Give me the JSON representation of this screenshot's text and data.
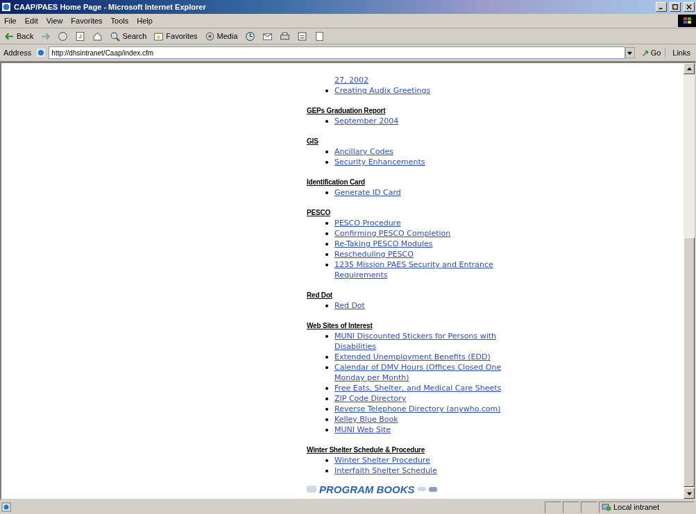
{
  "window": {
    "title": "CAAP/PAES Home Page - Microsoft Internet Explorer"
  },
  "menu": [
    "File",
    "Edit",
    "View",
    "Favorites",
    "Tools",
    "Help"
  ],
  "toolbar": [
    {
      "kind": "back",
      "label": "Back"
    },
    {
      "kind": "forward"
    },
    {
      "kind": "stop"
    },
    {
      "kind": "refresh"
    },
    {
      "kind": "home"
    },
    {
      "kind": "search",
      "label": "Search"
    },
    {
      "kind": "favorites",
      "label": "Favorites"
    },
    {
      "kind": "media",
      "label": "Media"
    },
    {
      "kind": "history"
    },
    {
      "kind": "mail"
    },
    {
      "kind": "print"
    },
    {
      "kind": "edit"
    },
    {
      "kind": "discuss"
    }
  ],
  "address_bar": {
    "label": "Address",
    "value": "http://dhsintranet/Caap/index.cfm",
    "go": "Go",
    "links": "Links"
  },
  "sections": [
    {
      "items": [
        {
          "kind": "continuation",
          "text": "27, 2002"
        },
        {
          "kind": "link",
          "text": "Creating Audix Greetings"
        }
      ]
    },
    {
      "heading": "GEPs Graduation Report",
      "items": [
        {
          "kind": "link",
          "text": "September 2004"
        }
      ]
    },
    {
      "heading": "GIS",
      "items": [
        {
          "kind": "link",
          "text": "Ancillary Codes"
        },
        {
          "kind": "link",
          "text": "Security Enhancements"
        }
      ]
    },
    {
      "heading": "Identification Card",
      "items": [
        {
          "kind": "link",
          "text": "Generate ID Card"
        }
      ]
    },
    {
      "heading": "PESCO",
      "items": [
        {
          "kind": "link",
          "text": "PESCO Procedure"
        },
        {
          "kind": "link",
          "text": "Confirming PESCO Completion"
        },
        {
          "kind": "link",
          "text": "Re-Taking PESCO Modules"
        },
        {
          "kind": "link",
          "text": "Rescheduling PESCO"
        },
        {
          "kind": "link",
          "text": "1235 Mission PAES Security and Entrance Requirements"
        }
      ]
    },
    {
      "heading": "Red Dot",
      "items": [
        {
          "kind": "link",
          "text": "Red Dot"
        }
      ]
    },
    {
      "heading": "Web Sites of Interest",
      "items": [
        {
          "kind": "link",
          "text": "MUNI Discounted Stickers for Persons with Disabilities"
        },
        {
          "kind": "link",
          "text": "Extended Unemployment Benefits (EDD)"
        },
        {
          "kind": "link",
          "text": "Calendar of DMV Hours (Offices Closed One Monday per Month)"
        },
        {
          "kind": "link",
          "text": "Free Eats, Shelter, and Medical Care Sheets"
        },
        {
          "kind": "link",
          "text": "ZIP Code Directory"
        },
        {
          "kind": "link",
          "text": "Reverse Telephone Directory (anywho.com)"
        },
        {
          "kind": "link",
          "text": "Kelley Blue Book"
        },
        {
          "kind": "link",
          "text": "MUNI Web Site"
        }
      ]
    },
    {
      "heading": "Winter Shelter Schedule & Procedure",
      "items": [
        {
          "kind": "link",
          "text": "Winter Shelter Procedure"
        },
        {
          "kind": "link",
          "text": "Interfaith Shelter Schedule"
        }
      ]
    }
  ],
  "banner": {
    "text": "PROGRAM BOOKS"
  },
  "status_bar": {
    "zone": "Local intranet"
  }
}
